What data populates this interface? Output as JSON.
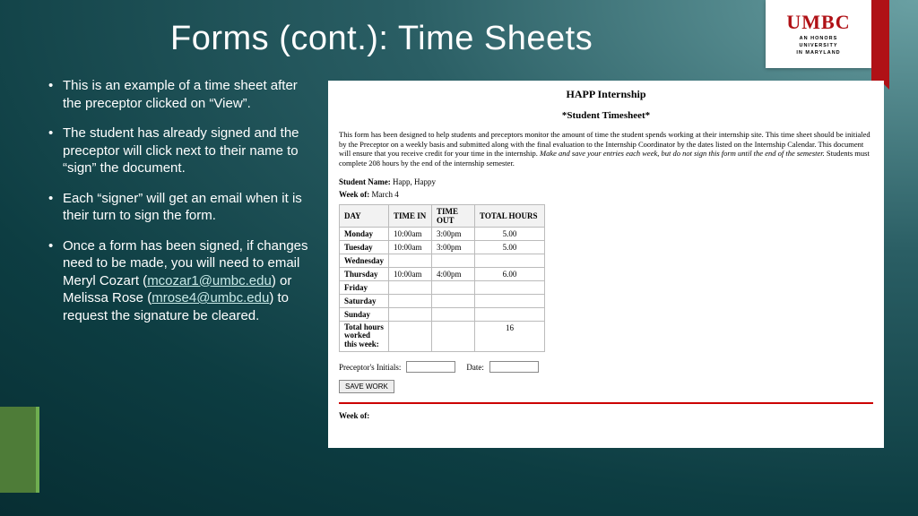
{
  "title": "Forms (cont.):  Time Sheets",
  "logo": {
    "word": "UMBC",
    "sub": "AN HONORS\nUNIVERSITY\nIN MARYLAND"
  },
  "bullets": [
    {
      "text_a": "This is an example of a time sheet after the preceptor clicked on “View”."
    },
    {
      "text_a": "The student has already signed and the preceptor will click next to their name to “sign” the document."
    },
    {
      "text_a": "Each “signer” will get an email when it is their turn to sign the form."
    },
    {
      "text_a": "Once a form has been signed, if changes need to be made, you will need to email Meryl Cozart (",
      "link1": "mcozar1@umbc.edu",
      "text_b": ") or Melissa Rose (",
      "link2": "mrose4@umbc.edu",
      "text_c": ") to request the signature be cleared."
    }
  ],
  "sheet": {
    "h1": "HAPP Internship",
    "h2": "*Student Timesheet*",
    "instr_plain": "This form has been designed to help students and preceptors monitor the amount of time the student spends working at their internship site. This time sheet should be initialed by the Preceptor on a weekly basis and submitted along with the final evaluation to the Internship Coordinator by the dates listed on the Internship Calendar. This document will ensure that you receive credit for your time in the internship. ",
    "instr_em": "Make and save your entries each week, but do not sign this form until the end of the semester.",
    "instr_tail": " Students must complete 208 hours by the end of the internship semester.",
    "name_label": "Student Name:",
    "name_value": "Happ, Happy",
    "week_label": "Week of:",
    "week_value": "March 4",
    "headers": [
      "DAY",
      "TIME IN",
      "TIME OUT",
      "TOTAL HOURS"
    ],
    "rows": [
      {
        "d": "Monday",
        "in": "10:00am",
        "out": "3:00pm",
        "h": "5.00"
      },
      {
        "d": "Tuesday",
        "in": "10:00am",
        "out": "3:00pm",
        "h": "5.00"
      },
      {
        "d": "Wednesday",
        "in": "",
        "out": "",
        "h": ""
      },
      {
        "d": "Thursday",
        "in": "10:00am",
        "out": "4:00pm",
        "h": "6.00"
      },
      {
        "d": "Friday",
        "in": "",
        "out": "",
        "h": ""
      },
      {
        "d": "Saturday",
        "in": "",
        "out": "",
        "h": ""
      },
      {
        "d": "Sunday",
        "in": "",
        "out": "",
        "h": ""
      }
    ],
    "total_label": "Total hours worked this week:",
    "total_value": "16",
    "initials_label": "Preceptor's Initials:",
    "date_label": "Date:",
    "save": "SAVE WORK",
    "week2": "Week of:"
  }
}
